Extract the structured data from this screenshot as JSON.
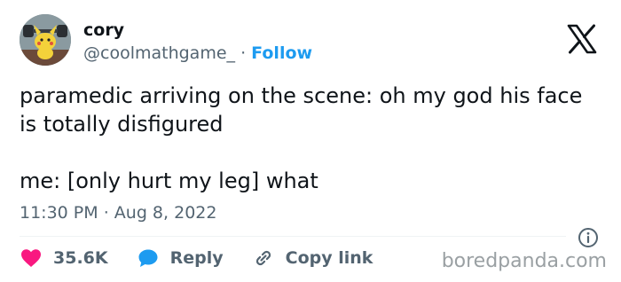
{
  "author": {
    "name": "cory",
    "handle": "@coolmathgame_",
    "separator": "·",
    "follow_label": "Follow"
  },
  "tweet": {
    "line1": "paramedic arriving on the scene: oh my god his face is totally disfigured",
    "line2": "me: [only hurt my leg] what"
  },
  "timestamp": {
    "time": "11:30 PM",
    "separator": "·",
    "date": "Aug 8, 2022"
  },
  "actions": {
    "likes": "35.6K",
    "reply": "Reply",
    "copy_link": "Copy link"
  },
  "watermark": "boredpanda.com",
  "colors": {
    "text": "#0f1419",
    "secondary": "#536471",
    "accent": "#1d9bf0",
    "like": "#f91880"
  },
  "icons": [
    "x-logo-icon",
    "info-icon",
    "heart-icon",
    "reply-bubble-icon",
    "link-icon"
  ]
}
